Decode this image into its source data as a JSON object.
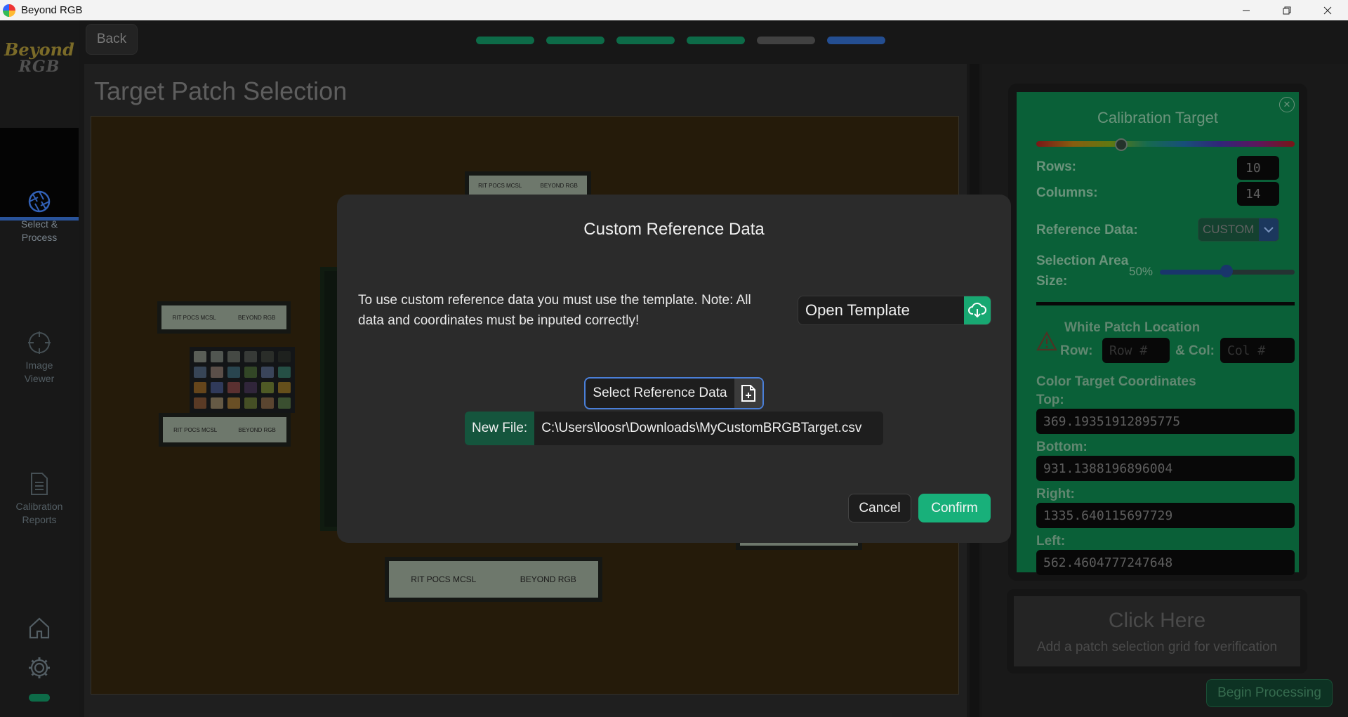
{
  "window": {
    "title": "Beyond RGB"
  },
  "logo": {
    "line1": "Beyond",
    "line2": "RGB"
  },
  "sidebar": {
    "items": [
      {
        "label": "Select &\nProcess",
        "icon": "aperture-icon",
        "active": true
      },
      {
        "label": "Image\nViewer",
        "icon": "crosshair-icon",
        "active": false
      },
      {
        "label": "Calibration\nReports",
        "icon": "document-icon",
        "active": false
      }
    ]
  },
  "header": {
    "back_label": "Back",
    "progress_colors": [
      "#0f7a52",
      "#0f7a52",
      "#0f7a52",
      "#0f7a52",
      "#4a4a4a",
      "#2a59a5"
    ]
  },
  "main": {
    "title": "Target Patch Selection"
  },
  "photo_strips": {
    "text_a": "RIT POCS MCSL",
    "text_b": "BEYOND RGB"
  },
  "calibration": {
    "title": "Calibration Target",
    "rows_label": "Rows:",
    "rows_value": "10",
    "columns_label": "Columns:",
    "columns_value": "14",
    "reference_label": "Reference Data:",
    "reference_value": "CUSTOM",
    "selection_label_1": "Selection Area",
    "selection_label_2": "Size:",
    "selection_value": "50%",
    "selection_fraction": 0.5,
    "white_patch_label": "White Patch Location",
    "row_label": "Row:",
    "row_placeholder": "Row #",
    "col_label": "& Col:",
    "col_placeholder": "Col #",
    "coords_label": "Color Target Coordinates",
    "top_label": "Top:",
    "top_value": "369.19351912895775",
    "bottom_label": "Bottom:",
    "bottom_value": "931.1388196896004",
    "right_label": "Right:",
    "right_value": "1335.640115697729",
    "left_label": "Left:",
    "left_value": "562.4604777247648"
  },
  "verify": {
    "title": "Click Here",
    "subtitle": "Add a patch selection grid for verification"
  },
  "begin_label": "Begin Processing",
  "modal": {
    "title": "Custom Reference Data",
    "text": "To use custom reference data you must use the template. Note: All data and coordinates must be inputed correctly!",
    "open_template_label": "Open Template",
    "select_reference_label": "Select Reference Data",
    "new_file_label": "New File:",
    "new_file_path": "C:\\Users\\loosr\\Downloads\\MyCustomBRGBTarget.csv",
    "cancel_label": "Cancel",
    "confirm_label": "Confirm"
  }
}
